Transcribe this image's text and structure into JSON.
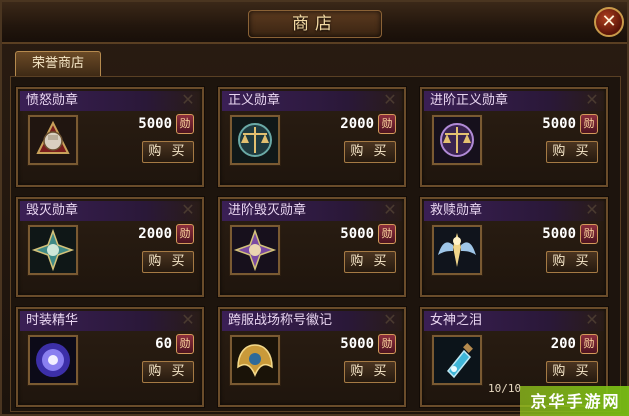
{
  "window": {
    "title": "商店",
    "close_symbol": "✕"
  },
  "tabs": [
    {
      "label": "荣誉商店",
      "selected": true
    }
  ],
  "buy_label": "购 买",
  "currency_icon": "honor-coin-icon",
  "items": [
    {
      "name": "愤怒勋章",
      "price": "5000",
      "icon": "fist-medal-icon"
    },
    {
      "name": "正义勋章",
      "price": "2000",
      "icon": "scales-medal-icon"
    },
    {
      "name": "进阶正义勋章",
      "price": "5000",
      "icon": "scales-medal-icon"
    },
    {
      "name": "毁灭勋章",
      "price": "2000",
      "icon": "star-medal-icon"
    },
    {
      "name": "进阶毁灭勋章",
      "price": "5000",
      "icon": "star-medal-icon"
    },
    {
      "name": "救赎勋章",
      "price": "5000",
      "icon": "angel-medal-icon"
    },
    {
      "name": "时装精华",
      "price": "60",
      "icon": "energy-orb-icon"
    },
    {
      "name": "跨服战场称号徽记",
      "price": "5000",
      "icon": "winged-emblem-icon"
    },
    {
      "name": "女神之泪",
      "price": "200",
      "icon": "potion-icon"
    }
  ],
  "pagination": {
    "text": "10/10"
  },
  "watermark": {
    "text": "京华手游网"
  },
  "colors": {
    "accent": "#c99a4a",
    "header_purple": "#3a1f55",
    "price_text": "#ffffff"
  }
}
